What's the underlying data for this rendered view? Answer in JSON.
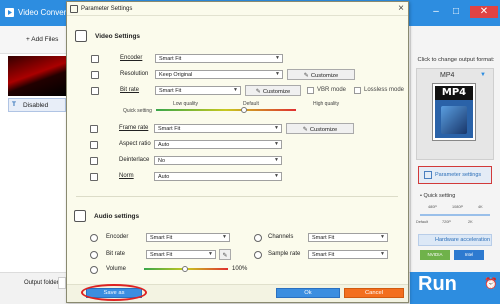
{
  "app": {
    "title": "Video Conver",
    "add_files": "+ Add Files",
    "disabled_label": "Disabled",
    "output_folder_label": "Output folder:",
    "right_panel": {
      "caption": "Click to change output format:",
      "format": "MP4",
      "format_icon_text": "MP4",
      "parameter_settings": "Parameter settings",
      "quick_setting": "Quick setting",
      "slider_top_labels": [
        "480P",
        "1080P",
        "4K"
      ],
      "slider_bottom_labels": [
        "Default",
        "720P",
        "2K"
      ],
      "hardware_acceleration": "Hardware acceleration",
      "brands": [
        "NVIDIA",
        "Intel"
      ],
      "run": "Run"
    }
  },
  "dialog": {
    "title": "Parameter Settings",
    "video": {
      "heading": "Video Settings",
      "encoder": {
        "label": "Encoder",
        "value": "Smart Fit"
      },
      "resolution": {
        "label": "Resolution",
        "value": "Keep Original",
        "button": "Customize"
      },
      "bitrate": {
        "label": "Bit rate",
        "value": "Smart Fit",
        "button": "Customize",
        "vbr": "VBR mode",
        "lossless": "Lossless mode"
      },
      "quality": {
        "label": "Quick setting",
        "low": "Low quality",
        "default": "Default",
        "high": "High quality",
        "level": 0.63
      },
      "framerate": {
        "label": "Frame rate",
        "value": "Smart Fit",
        "button": "Customize"
      },
      "aspect": {
        "label": "Aspect ratio",
        "value": "Auto"
      },
      "deinterlace": {
        "label": "Deinterlace",
        "value": "No"
      },
      "norm": {
        "label": "Norm",
        "value": "Auto"
      }
    },
    "audio": {
      "heading": "Audio settings",
      "encoder": {
        "label": "Encoder",
        "value": "Smart Fit"
      },
      "channels": {
        "label": "Channels",
        "value": "Smart Fit"
      },
      "bitrate": {
        "label": "Bit rate",
        "value": "Smart Fit"
      },
      "samplerate": {
        "label": "Sample rate",
        "value": "Smart Fit"
      },
      "volume": {
        "label": "Volume",
        "value": "100%"
      }
    },
    "footer": {
      "save_as": "Save as",
      "ok": "Ok",
      "cancel": "Cancel"
    }
  },
  "colors": {
    "accent": "#2d8de0",
    "highlight": "#d22222",
    "cancel": "#f36f1f"
  }
}
